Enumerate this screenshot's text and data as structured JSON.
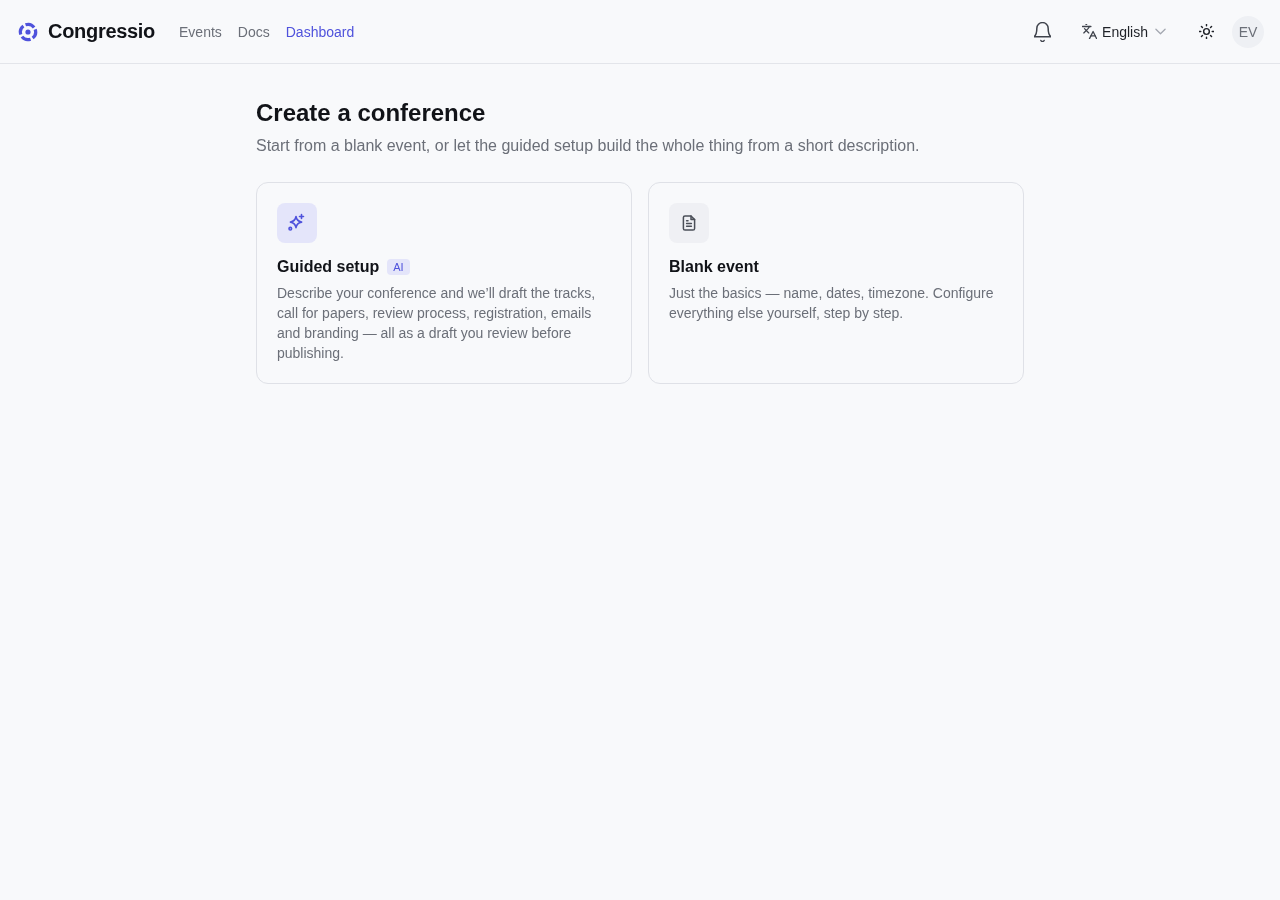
{
  "app": {
    "name": "Congressio"
  },
  "nav": [
    {
      "label": "Events",
      "selected": false
    },
    {
      "label": "Docs",
      "selected": false
    },
    {
      "label": "Dashboard",
      "selected": true
    }
  ],
  "language": {
    "label": "English"
  },
  "user": {
    "initials": "EV"
  },
  "page": {
    "title": "Create a conference",
    "subtitle": "Start from a blank event, or let the guided setup build the whole thing from a short description."
  },
  "options": [
    {
      "kind": "guided",
      "title": "Guided setup",
      "badge": "AI",
      "description": "Describe your conference and we’ll draft the tracks, call for papers, review process, registration, emails and branding — all as a draft you review before publishing."
    },
    {
      "kind": "blank",
      "title": "Blank event",
      "description": "Just the basics — name, dates, timezone. Configure everything else yourself, step by step."
    }
  ]
}
